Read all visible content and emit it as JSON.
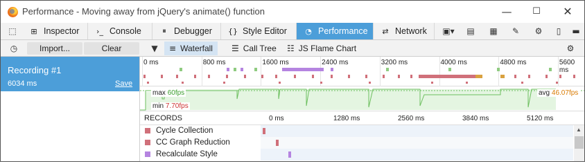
{
  "window": {
    "title": "Performance - Moving away from jQuery's animate() function",
    "controls": [
      "minimize-icon",
      "maximize-icon",
      "close-icon"
    ]
  },
  "toolbar": {
    "tabs": [
      {
        "label": "Inspector",
        "icon": "inspector-icon"
      },
      {
        "label": "Console",
        "icon": "console-icon"
      },
      {
        "label": "Debugger",
        "icon": "debugger-icon"
      },
      {
        "label": "Style Editor",
        "icon": "style-editor-icon"
      },
      {
        "label": "Performance",
        "icon": "performance-icon",
        "selected": true
      },
      {
        "label": "Network",
        "icon": "network-icon"
      }
    ],
    "right_icons": [
      "responsive-layout-icon",
      "scratchpad-icon",
      "screenshot-icon",
      "eyedropper-icon",
      "settings-icon",
      "dock-side-icon",
      "dock-bottom-icon",
      "close-devtools-icon"
    ]
  },
  "subbar": {
    "import_label": "Import...",
    "clear_label": "Clear",
    "views": [
      {
        "label": "Waterfall",
        "icon": "waterfall-icon",
        "selected": true
      },
      {
        "label": "Call Tree",
        "icon": "call-tree-icon"
      },
      {
        "label": "JS Flame Chart",
        "icon": "flame-chart-icon"
      }
    ]
  },
  "recording": {
    "name": "Recording #1",
    "duration": "6034 ms",
    "save_label": "Save"
  },
  "overview": {
    "ticks": [
      "0 ms",
      "800 ms",
      "1600 ms",
      "2400 ms",
      "3200 ms",
      "4000 ms",
      "4800 ms",
      "5600 ms"
    ]
  },
  "fps": {
    "max_label": "max",
    "max_value": "60",
    "min_label": "min",
    "min_value": "7.70",
    "avg_label": "avg",
    "avg_value": "46.07",
    "unit": "fps"
  },
  "waterfall": {
    "records_header": "RECORDS",
    "ticks": [
      "0 ms",
      "1280 ms",
      "2560 ms",
      "3840 ms",
      "5120 ms"
    ],
    "rows": [
      {
        "label": "Cycle Collection",
        "color": "#d0707a"
      },
      {
        "label": "CC Graph Reduction",
        "color": "#d0707a"
      },
      {
        "label": "Recalculate Style",
        "color": "#b584e0"
      }
    ]
  },
  "colors": {
    "accent": "#4c9ed9",
    "gc": "#d0707a",
    "style": "#b584e0",
    "script": "#8fcb80",
    "paint": "#d9a140"
  }
}
